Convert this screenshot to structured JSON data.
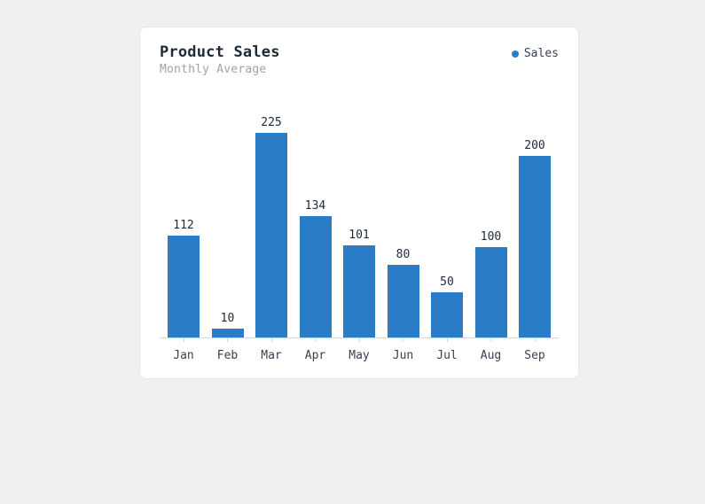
{
  "chart_data": {
    "type": "bar",
    "title": "Product Sales",
    "subtitle": "Monthly Average",
    "legend": {
      "label": "Sales",
      "color": "#2a7cc7"
    },
    "categories": [
      "Jan",
      "Feb",
      "Mar",
      "Apr",
      "May",
      "Jun",
      "Jul",
      "Aug",
      "Sep"
    ],
    "values": [
      112,
      10,
      225,
      134,
      101,
      80,
      50,
      100,
      200
    ],
    "ylim": [
      0,
      240
    ],
    "xlabel": "",
    "ylabel": ""
  }
}
